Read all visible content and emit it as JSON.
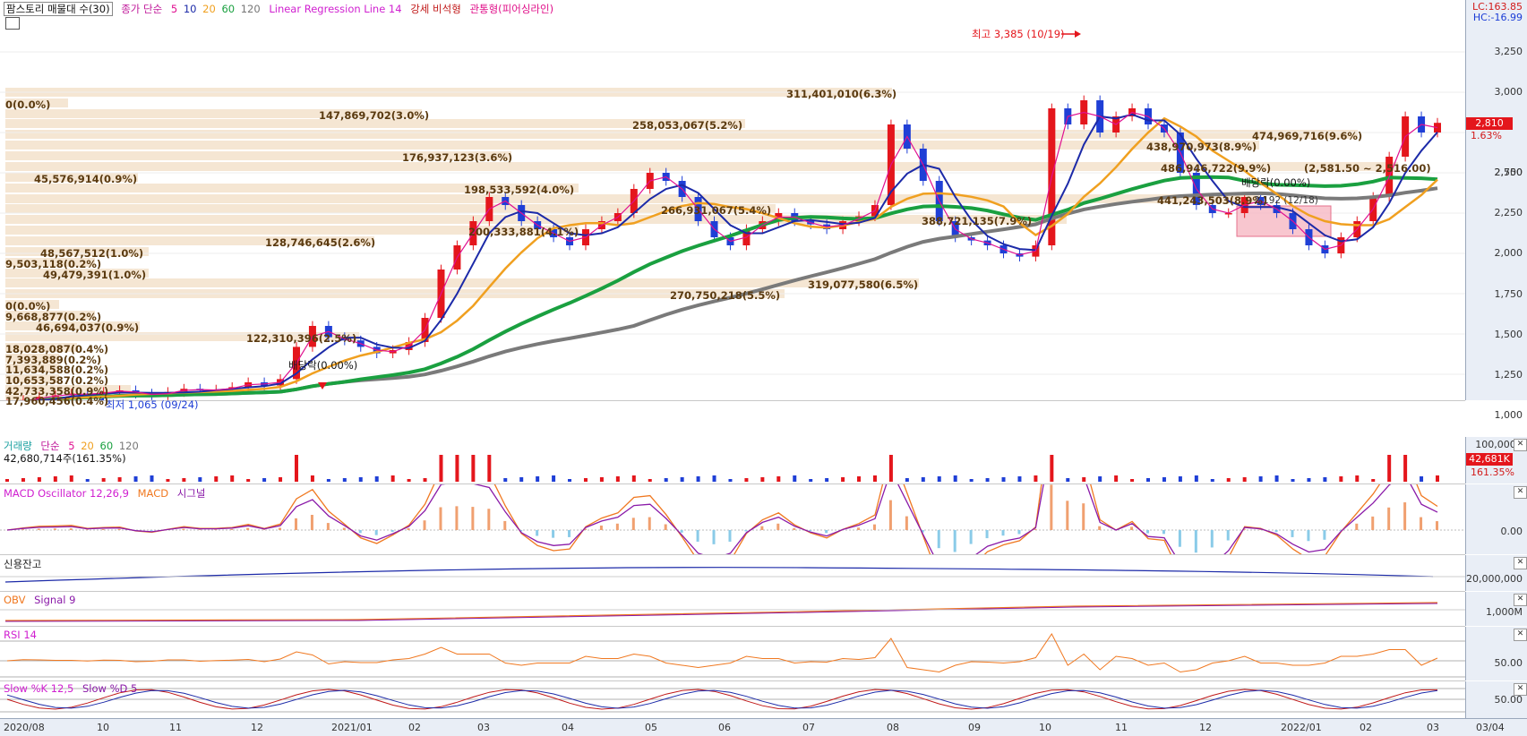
{
  "main_legend": {
    "stock": "팜스토리 매물대 수(30)",
    "ma_label": "종가 단순",
    "ma_periods": [
      "5",
      "10",
      "20",
      "60",
      "120"
    ],
    "linreg": "Linear Regression Line 14",
    "strong_box": "강세 비석형",
    "piercing": "관통형(피어싱라인)"
  },
  "corner": {
    "lc": "LC:163.85",
    "hc": "HC:-16.99"
  },
  "price_axis": [
    "3,250",
    "3,000",
    "2,750",
    "2,500",
    "2,250",
    "2,000",
    "1,750",
    "1,500",
    "1,250",
    "1,000"
  ],
  "current_price": {
    "value": "2,810",
    "change": "1.63%"
  },
  "annotations": {
    "high": "최고 3,385 (10/19)",
    "low": "최저 1,065 (09/24)",
    "dividend1": "배당락(0.00%)",
    "dividend2": "배당락(0.00%)",
    "box_label": "2,192 (12/18)"
  },
  "volume_profile": [
    {
      "label": "311,401,010(6.3%)"
    },
    {
      "label": "0(0.0%)"
    },
    {
      "label": "147,869,702(3.0%)"
    },
    {
      "label": "258,053,067(5.2%)"
    },
    {
      "label": "474,969,716(9.6%)"
    },
    {
      "label": "438,970,973(8.9%)"
    },
    {
      "label": "176,937,123(3.6%)"
    },
    {
      "label": "486,946,722(9.9%)"
    },
    {
      "label": "(2,581.50 ~ 2,516.00)"
    },
    {
      "label": "45,576,914(0.9%)"
    },
    {
      "label": "198,533,592(4.0%)"
    },
    {
      "label": "441,243,503(8.9%)"
    },
    {
      "label": "266,931,067(5.4%)"
    },
    {
      "label": "200,333,881(4.1%)"
    },
    {
      "label": "388,721,135(7.9%)"
    },
    {
      "label": "128,746,645(2.6%)"
    },
    {
      "label": "48,567,512(1.0%)"
    },
    {
      "label": "9,503,118(0.2%)"
    },
    {
      "label": "49,479,391(1.0%)"
    },
    {
      "label": "319,077,580(6.5%)"
    },
    {
      "label": "270,750,218(5.5%)"
    },
    {
      "label": "0(0.0%)"
    },
    {
      "label": "9,668,877(0.2%)"
    },
    {
      "label": "46,694,037(0.9%)"
    },
    {
      "label": "122,310,396(2.5%)"
    },
    {
      "label": "18,028,087(0.4%)"
    },
    {
      "label": "7,393,889(0.2%)"
    },
    {
      "label": "11,634,588(0.2%)"
    },
    {
      "label": "10,653,587(0.2%)"
    },
    {
      "label": "42,733,358(0.9%)"
    },
    {
      "label": "17,960,456(0.4%)"
    }
  ],
  "volume_panel": {
    "title": "거래량",
    "ma_label": "단순",
    "ma_periods": [
      "5",
      "20",
      "60",
      "120"
    ],
    "value": "42,680,714주(161.35%)",
    "axis_top": "100,000K",
    "badge": "42,681K",
    "badge_pct": "161.35%"
  },
  "macd_panel": {
    "osc": "MACD Oscillator 12,26,9",
    "macd": "MACD",
    "signal": "시그널",
    "axis": "0.00"
  },
  "credit_panel": {
    "title": "신용잔고",
    "axis": "20,000,000"
  },
  "obv_panel": {
    "title": "OBV",
    "signal": "Signal 9",
    "axis": "1,000M"
  },
  "rsi_panel": {
    "title": "RSI 14",
    "axis": "50.00"
  },
  "stoch_panel": {
    "k": "Slow %K 12,5",
    "d": "Slow %D 5",
    "axis": "50.00"
  },
  "dates": [
    "2020/08",
    "10",
    "11",
    "12",
    "2021/01",
    "02",
    "03",
    "04",
    "05",
    "06",
    "07",
    "08",
    "09",
    "10",
    "11",
    "12",
    "2022/01",
    "02",
    "03",
    "03/04"
  ],
  "colors": {
    "up": "#e4161c",
    "down": "#1f3fd6",
    "ma5": "#e01090",
    "ma10": "#1c2aa8",
    "ma20": "#f0a020",
    "ma60": "#1aa040",
    "ma120": "#7a7a7a",
    "vp": "#f5e6d3"
  },
  "price_series": [
    1065,
    1090,
    1110,
    1120,
    1130,
    1125,
    1140,
    1150,
    1130,
    1120,
    1140,
    1160,
    1150,
    1155,
    1170,
    1200,
    1180,
    1220,
    1420,
    1550,
    1480,
    1460,
    1420,
    1380,
    1400,
    1450,
    1600,
    1900,
    2050,
    2200,
    2350,
    2300,
    2200,
    2150,
    2100,
    2050,
    2150,
    2200,
    2250,
    2400,
    2500,
    2450,
    2350,
    2200,
    2100,
    2050,
    2150,
    2200,
    2250,
    2200,
    2180,
    2150,
    2200,
    2230,
    2300,
    2800,
    2650,
    2450,
    2200,
    2100,
    2080,
    2050,
    2000,
    1980,
    2050,
    2900,
    2800,
    2950,
    2750,
    2850,
    2900,
    2800,
    2750,
    2500,
    2300,
    2250,
    2250,
    2350,
    2300,
    2250,
    2150,
    2050,
    2000,
    2100,
    2200,
    2350,
    2600,
    2850,
    2750,
    2810
  ]
}
